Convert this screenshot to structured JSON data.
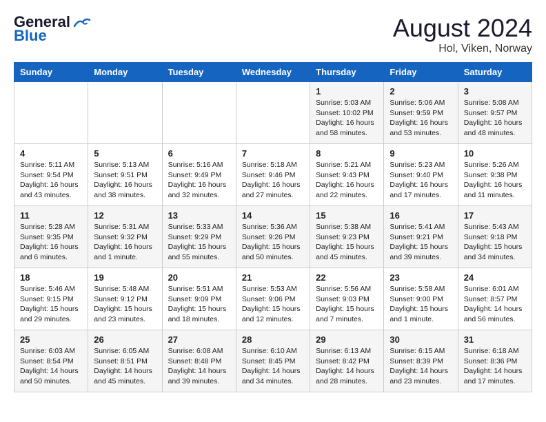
{
  "header": {
    "logo_line1": "General",
    "logo_line2": "Blue",
    "month_year": "August 2024",
    "location": "Hol, Viken, Norway"
  },
  "days_of_week": [
    "Sunday",
    "Monday",
    "Tuesday",
    "Wednesday",
    "Thursday",
    "Friday",
    "Saturday"
  ],
  "weeks": [
    [
      {
        "day": "",
        "content": ""
      },
      {
        "day": "",
        "content": ""
      },
      {
        "day": "",
        "content": ""
      },
      {
        "day": "",
        "content": ""
      },
      {
        "day": "1",
        "content": "Sunrise: 5:03 AM\nSunset: 10:02 PM\nDaylight: 16 hours\nand 58 minutes."
      },
      {
        "day": "2",
        "content": "Sunrise: 5:06 AM\nSunset: 9:59 PM\nDaylight: 16 hours\nand 53 minutes."
      },
      {
        "day": "3",
        "content": "Sunrise: 5:08 AM\nSunset: 9:57 PM\nDaylight: 16 hours\nand 48 minutes."
      }
    ],
    [
      {
        "day": "4",
        "content": "Sunrise: 5:11 AM\nSunset: 9:54 PM\nDaylight: 16 hours\nand 43 minutes."
      },
      {
        "day": "5",
        "content": "Sunrise: 5:13 AM\nSunset: 9:51 PM\nDaylight: 16 hours\nand 38 minutes."
      },
      {
        "day": "6",
        "content": "Sunrise: 5:16 AM\nSunset: 9:49 PM\nDaylight: 16 hours\nand 32 minutes."
      },
      {
        "day": "7",
        "content": "Sunrise: 5:18 AM\nSunset: 9:46 PM\nDaylight: 16 hours\nand 27 minutes."
      },
      {
        "day": "8",
        "content": "Sunrise: 5:21 AM\nSunset: 9:43 PM\nDaylight: 16 hours\nand 22 minutes."
      },
      {
        "day": "9",
        "content": "Sunrise: 5:23 AM\nSunset: 9:40 PM\nDaylight: 16 hours\nand 17 minutes."
      },
      {
        "day": "10",
        "content": "Sunrise: 5:26 AM\nSunset: 9:38 PM\nDaylight: 16 hours\nand 11 minutes."
      }
    ],
    [
      {
        "day": "11",
        "content": "Sunrise: 5:28 AM\nSunset: 9:35 PM\nDaylight: 16 hours\nand 6 minutes."
      },
      {
        "day": "12",
        "content": "Sunrise: 5:31 AM\nSunset: 9:32 PM\nDaylight: 16 hours\nand 1 minute."
      },
      {
        "day": "13",
        "content": "Sunrise: 5:33 AM\nSunset: 9:29 PM\nDaylight: 15 hours\nand 55 minutes."
      },
      {
        "day": "14",
        "content": "Sunrise: 5:36 AM\nSunset: 9:26 PM\nDaylight: 15 hours\nand 50 minutes."
      },
      {
        "day": "15",
        "content": "Sunrise: 5:38 AM\nSunset: 9:23 PM\nDaylight: 15 hours\nand 45 minutes."
      },
      {
        "day": "16",
        "content": "Sunrise: 5:41 AM\nSunset: 9:21 PM\nDaylight: 15 hours\nand 39 minutes."
      },
      {
        "day": "17",
        "content": "Sunrise: 5:43 AM\nSunset: 9:18 PM\nDaylight: 15 hours\nand 34 minutes."
      }
    ],
    [
      {
        "day": "18",
        "content": "Sunrise: 5:46 AM\nSunset: 9:15 PM\nDaylight: 15 hours\nand 29 minutes."
      },
      {
        "day": "19",
        "content": "Sunrise: 5:48 AM\nSunset: 9:12 PM\nDaylight: 15 hours\nand 23 minutes."
      },
      {
        "day": "20",
        "content": "Sunrise: 5:51 AM\nSunset: 9:09 PM\nDaylight: 15 hours\nand 18 minutes."
      },
      {
        "day": "21",
        "content": "Sunrise: 5:53 AM\nSunset: 9:06 PM\nDaylight: 15 hours\nand 12 minutes."
      },
      {
        "day": "22",
        "content": "Sunrise: 5:56 AM\nSunset: 9:03 PM\nDaylight: 15 hours\nand 7 minutes."
      },
      {
        "day": "23",
        "content": "Sunrise: 5:58 AM\nSunset: 9:00 PM\nDaylight: 15 hours\nand 1 minute."
      },
      {
        "day": "24",
        "content": "Sunrise: 6:01 AM\nSunset: 8:57 PM\nDaylight: 14 hours\nand 56 minutes."
      }
    ],
    [
      {
        "day": "25",
        "content": "Sunrise: 6:03 AM\nSunset: 8:54 PM\nDaylight: 14 hours\nand 50 minutes."
      },
      {
        "day": "26",
        "content": "Sunrise: 6:05 AM\nSunset: 8:51 PM\nDaylight: 14 hours\nand 45 minutes."
      },
      {
        "day": "27",
        "content": "Sunrise: 6:08 AM\nSunset: 8:48 PM\nDaylight: 14 hours\nand 39 minutes."
      },
      {
        "day": "28",
        "content": "Sunrise: 6:10 AM\nSunset: 8:45 PM\nDaylight: 14 hours\nand 34 minutes."
      },
      {
        "day": "29",
        "content": "Sunrise: 6:13 AM\nSunset: 8:42 PM\nDaylight: 14 hours\nand 28 minutes."
      },
      {
        "day": "30",
        "content": "Sunrise: 6:15 AM\nSunset: 8:39 PM\nDaylight: 14 hours\nand 23 minutes."
      },
      {
        "day": "31",
        "content": "Sunrise: 6:18 AM\nSunset: 8:36 PM\nDaylight: 14 hours\nand 17 minutes."
      }
    ]
  ]
}
